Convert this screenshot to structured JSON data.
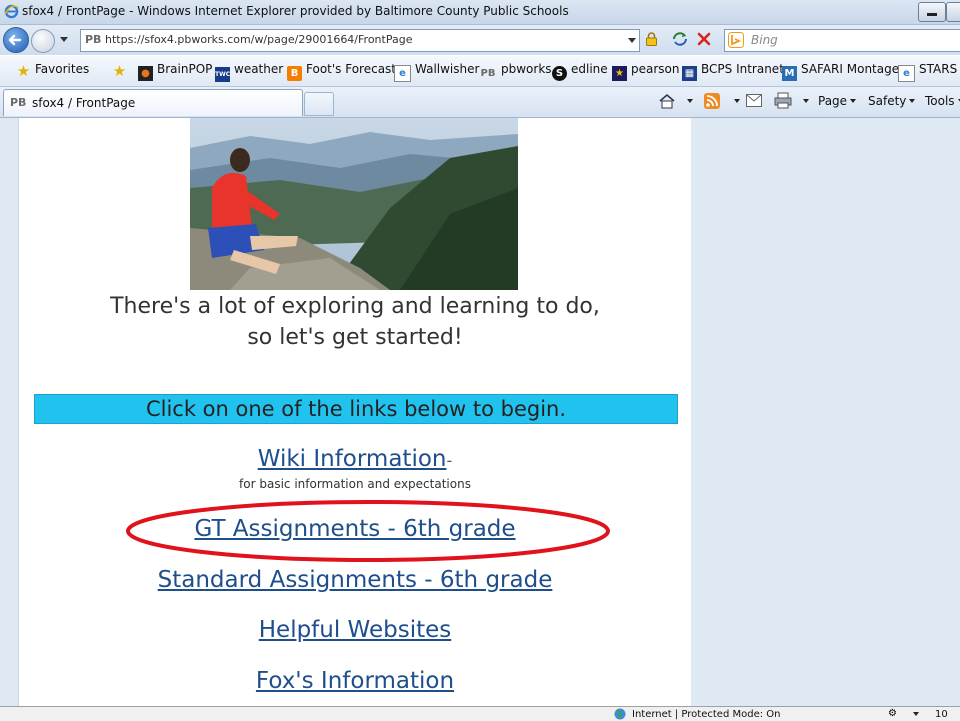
{
  "window": {
    "title": "sfox4 / FrontPage - Windows Internet Explorer provided by Baltimore County Public Schools"
  },
  "address_bar": {
    "site_badge": "PB",
    "url": "https://sfox4.pbworks.com/w/page/29001664/FrontPage"
  },
  "search": {
    "placeholder": "Bing"
  },
  "favorites_bar": {
    "favorites_label": "Favorites",
    "items": [
      {
        "label": "BrainPOP",
        "icon": "brainpop-icon",
        "color": "#e8761c"
      },
      {
        "label": "weather",
        "icon": "twc-icon",
        "badge": "TWC",
        "color": "#1a3a8a"
      },
      {
        "label": "Foot's Forecast",
        "icon": "blogger-icon",
        "badge": "B",
        "color": "#f57d00"
      },
      {
        "label": "Wallwisher",
        "icon": "ie-page-icon"
      },
      {
        "label": "pbworks",
        "icon": "pbworks-icon",
        "badge": "PB"
      },
      {
        "label": "edline",
        "icon": "edline-icon"
      },
      {
        "label": "pearson",
        "icon": "pearson-icon",
        "color": "#1b1b5e"
      },
      {
        "label": "BCPS Intranet",
        "icon": "bcps-icon",
        "color": "#1b3f8b"
      },
      {
        "label": "SAFARI Montage",
        "icon": "safari-montage-icon",
        "badge": "M",
        "color": "#2a6db5"
      },
      {
        "label": "STARS L",
        "icon": "ie-page-icon"
      }
    ]
  },
  "tabs": {
    "active": {
      "badge": "PB",
      "label": "sfox4 / FrontPage"
    }
  },
  "command_bar": {
    "page_label": "Page",
    "safety_label": "Safety",
    "tools_label": "Tools"
  },
  "content": {
    "tagline_1": "There's a lot of exploring and learning to do,",
    "tagline_2": "so let's get started!",
    "banner": "Click on one of the links below to begin.",
    "links": {
      "wiki_info": "Wiki Information",
      "wiki_info_dash": "-",
      "wiki_info_sub": "for basic information and expectations",
      "gt_assignments": "GT Assignments - 6th grade",
      "standard_assignments": "Standard Assignments - 6th grade",
      "helpful_websites": "Helpful Websites",
      "fox_info": "Fox's Information"
    },
    "highlight_color": "#e0121b",
    "banner_color": "#22c2ef"
  },
  "status_bar": {
    "zone": "Internet | Protected Mode: On",
    "zoom": "10"
  }
}
